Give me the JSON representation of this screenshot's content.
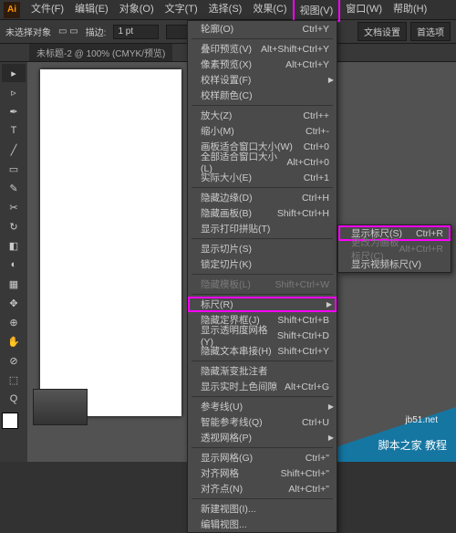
{
  "app": {
    "logo": "Ai"
  },
  "menubar": [
    "文件(F)",
    "编辑(E)",
    "对象(O)",
    "文字(T)",
    "选择(S)",
    "效果(C)",
    "视图(V)",
    "窗口(W)",
    "帮助(H)"
  ],
  "menubar_hl": 6,
  "control": {
    "noSelLabel": "未选择对象",
    "strokeLabel": "描边:",
    "strokeVal": "1 pt",
    "btnDoc": "文档设置",
    "btnPref": "首选项"
  },
  "docTab": "未标题-2 @ 100% (CMYK/预览)",
  "tools": [
    "▸",
    "▹",
    "✒",
    "T",
    "╱",
    "▭",
    "✎",
    "✂",
    "↻",
    "◧",
    "◐",
    "▦",
    "✥",
    "⊕",
    "✋",
    "⊘",
    "⬚",
    "Q"
  ],
  "viewMenu": [
    {
      "l": "轮廓(O)",
      "s": "Ctrl+Y"
    },
    {
      "sep": 1
    },
    {
      "l": "叠印预览(V)",
      "s": "Alt+Shift+Ctrl+Y"
    },
    {
      "l": "像素预览(X)",
      "s": "Alt+Ctrl+Y"
    },
    {
      "l": "校样设置(F)",
      "sub": 1
    },
    {
      "l": "校样颜色(C)"
    },
    {
      "sep": 1
    },
    {
      "l": "放大(Z)",
      "s": "Ctrl++"
    },
    {
      "l": "缩小(M)",
      "s": "Ctrl+-"
    },
    {
      "l": "画板适合窗口大小(W)",
      "s": "Ctrl+0"
    },
    {
      "l": "全部适合窗口大小(L)",
      "s": "Alt+Ctrl+0"
    },
    {
      "l": "实际大小(E)",
      "s": "Ctrl+1"
    },
    {
      "sep": 1
    },
    {
      "l": "隐藏边缘(D)",
      "s": "Ctrl+H"
    },
    {
      "l": "隐藏画板(B)",
      "s": "Shift+Ctrl+H"
    },
    {
      "l": "显示打印拼贴(T)"
    },
    {
      "sep": 1
    },
    {
      "l": "显示切片(S)"
    },
    {
      "l": "锁定切片(K)"
    },
    {
      "sep": 1
    },
    {
      "l": "隐藏模板(L)",
      "s": "Shift+Ctrl+W",
      "dis": 1
    },
    {
      "sep": 1
    },
    {
      "l": "标尺(R)",
      "sub": 1,
      "hl": 1
    },
    {
      "l": "隐藏定界框(J)",
      "s": "Shift+Ctrl+B"
    },
    {
      "l": "显示透明度网格(Y)",
      "s": "Shift+Ctrl+D"
    },
    {
      "l": "隐藏文本串接(H)",
      "s": "Shift+Ctrl+Y"
    },
    {
      "sep": 1
    },
    {
      "l": "隐藏渐变批注者"
    },
    {
      "l": "显示实时上色间隙",
      "s": "Alt+Ctrl+G"
    },
    {
      "sep": 1
    },
    {
      "l": "参考线(U)",
      "sub": 1
    },
    {
      "l": "智能参考线(Q)",
      "s": "Ctrl+U"
    },
    {
      "l": "透视网格(P)",
      "sub": 1
    },
    {
      "sep": 1
    },
    {
      "l": "显示网格(G)",
      "s": "Ctrl+\""
    },
    {
      "l": "对齐网格",
      "s": "Shift+Ctrl+\""
    },
    {
      "l": "对齐点(N)",
      "s": "Alt+Ctrl+\""
    },
    {
      "sep": 1
    },
    {
      "l": "新建视图(I)..."
    },
    {
      "l": "编辑视图..."
    }
  ],
  "rulerMenu": [
    {
      "l": "显示标尺(S)",
      "s": "Ctrl+R",
      "hl": 1
    },
    {
      "l": "更改为画板标尺(C)",
      "s": "Alt+Ctrl+R",
      "dis": 1
    },
    {
      "l": "显示视频标尺(V)"
    }
  ],
  "watermark": {
    "line1": "jb51.net",
    "line2": "脚本之家 教程"
  }
}
